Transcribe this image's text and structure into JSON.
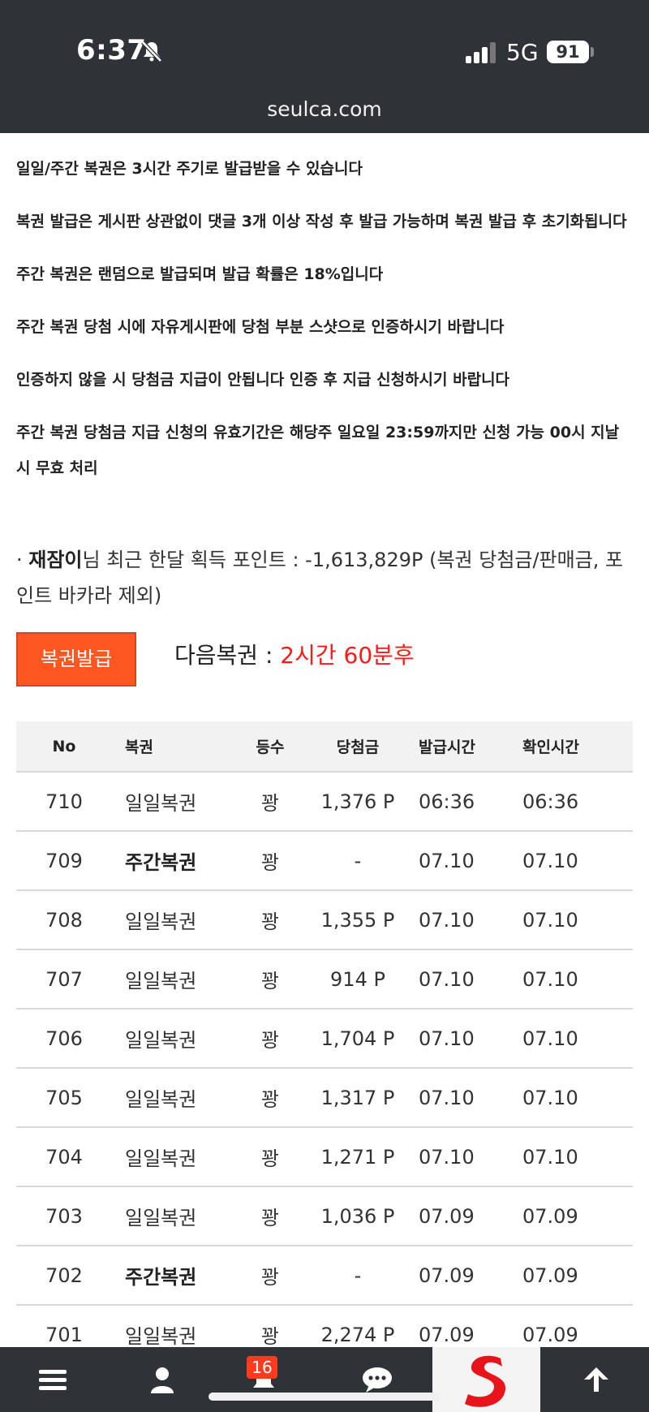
{
  "status_bar": {
    "time": "6:37",
    "network": "5G",
    "battery": "91"
  },
  "url": "seulca.com",
  "notices": [
    "일일/주간 복권은 3시간 주기로 발급받을 수 있습니다",
    "복권 발급은 게시판 상관없이 댓글 3개 이상 작성 후 발급 가능하며 복권 발급 후 초기화됩니다",
    "주간 복권은 랜덤으로 발급되며 발급 확률은 18%입니다",
    "주간 복권 당첨 시에 자유게시판에 당첨 부분 스샷으로 인증하시기 바랍니다",
    "인증하지 않을 시 당첨금 지급이 안됩니다 인증 후 지급 신청하시기 바랍니다",
    "주간 복권 당첨금 지급 신청의 유효기간은 해당주 일요일 23:59까지만 신청 가능 00시 지날 시 무효 처리"
  ],
  "points": {
    "prefix": "· ",
    "username": "재잠이",
    "text": "님 최근 한달 획득 포인트 : -1,613,829P (복권 당첨금/판매금, 포인트 바카라 제외)"
  },
  "issue_button": "복권발급",
  "next_lottery": {
    "label": "다음복권 : ",
    "value": "2시간 60분후"
  },
  "table": {
    "headers": [
      "No",
      "복권",
      "등수",
      "당첨금",
      "발급시간",
      "확인시간"
    ],
    "rows": [
      {
        "no": "710",
        "type": "일일복권",
        "rank": "꽝",
        "prize": "1,376 P",
        "issued": "06:36",
        "checked": "06:36",
        "weekly": false
      },
      {
        "no": "709",
        "type": "주간복권",
        "rank": "꽝",
        "prize": "-",
        "issued": "07.10",
        "checked": "07.10",
        "weekly": true
      },
      {
        "no": "708",
        "type": "일일복권",
        "rank": "꽝",
        "prize": "1,355 P",
        "issued": "07.10",
        "checked": "07.10",
        "weekly": false
      },
      {
        "no": "707",
        "type": "일일복권",
        "rank": "꽝",
        "prize": "914 P",
        "issued": "07.10",
        "checked": "07.10",
        "weekly": false
      },
      {
        "no": "706",
        "type": "일일복권",
        "rank": "꽝",
        "prize": "1,704 P",
        "issued": "07.10",
        "checked": "07.10",
        "weekly": false
      },
      {
        "no": "705",
        "type": "일일복권",
        "rank": "꽝",
        "prize": "1,317 P",
        "issued": "07.10",
        "checked": "07.10",
        "weekly": false
      },
      {
        "no": "704",
        "type": "일일복권",
        "rank": "꽝",
        "prize": "1,271 P",
        "issued": "07.10",
        "checked": "07.10",
        "weekly": false
      },
      {
        "no": "703",
        "type": "일일복권",
        "rank": "꽝",
        "prize": "1,036 P",
        "issued": "07.09",
        "checked": "07.09",
        "weekly": false
      },
      {
        "no": "702",
        "type": "주간복권",
        "rank": "꽝",
        "prize": "-",
        "issued": "07.09",
        "checked": "07.09",
        "weekly": true
      },
      {
        "no": "701",
        "type": "일일복권",
        "rank": "꽝",
        "prize": "2,274 P",
        "issued": "07.09",
        "checked": "07.09",
        "weekly": false
      }
    ]
  },
  "bottom_nav": {
    "notification_count": "16",
    "icons": [
      "menu-icon",
      "user-icon",
      "notification-icon",
      "chat-icon",
      "logo-icon",
      "arrow-up-icon"
    ]
  },
  "colors": {
    "accent": "#ff5722",
    "highlight": "#ff1a1a",
    "bar": "#2f3337"
  }
}
